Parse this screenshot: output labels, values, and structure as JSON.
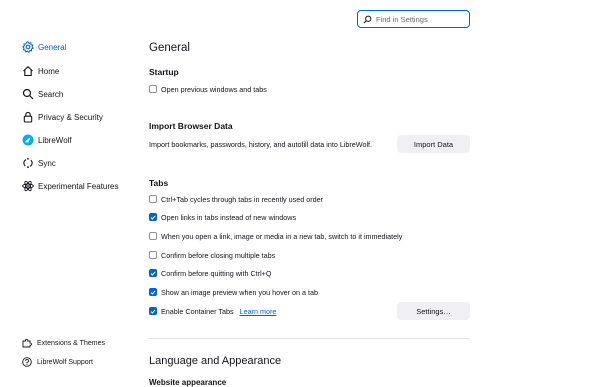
{
  "search": {
    "placeholder": "Find in Settings"
  },
  "sidebar": {
    "items": [
      {
        "label": "General"
      },
      {
        "label": "Home"
      },
      {
        "label": "Search"
      },
      {
        "label": "Privacy & Security"
      },
      {
        "label": "LibreWolf"
      },
      {
        "label": "Sync"
      },
      {
        "label": "Experimental Features"
      }
    ],
    "footer": [
      {
        "label": "Extensions & Themes"
      },
      {
        "label": "LibreWolf Support"
      }
    ]
  },
  "main": {
    "title": "General",
    "startup": {
      "heading": "Startup",
      "open_previous": {
        "label": "Open previous windows and tabs",
        "checked": false
      }
    },
    "import": {
      "heading": "Import Browser Data",
      "description": "Import bookmarks, passwords, history, and autofill data into LibreWolf.",
      "button": "Import Data"
    },
    "tabs": {
      "heading": "Tabs",
      "options": [
        {
          "label": "Ctrl+Tab cycles through tabs in recently used order",
          "checked": false
        },
        {
          "label": "Open links in tabs instead of new windows",
          "checked": true
        },
        {
          "label": "When you open a link, image or media in a new tab, switch to it immediately",
          "checked": false
        },
        {
          "label": "Confirm before closing multiple tabs",
          "checked": false
        },
        {
          "label": "Confirm before quitting with Ctrl+Q",
          "checked": true
        },
        {
          "label": "Show an image preview when you hover on a tab",
          "checked": true
        },
        {
          "label": "Enable Container Tabs",
          "checked": true
        }
      ],
      "learn_more": "Learn more",
      "settings_button": "Settings…"
    },
    "language": {
      "heading": "Language and Appearance",
      "subheading": "Website appearance"
    }
  },
  "colors": {
    "accent": "#0061e0",
    "button_bg": "#f0f0f4"
  }
}
